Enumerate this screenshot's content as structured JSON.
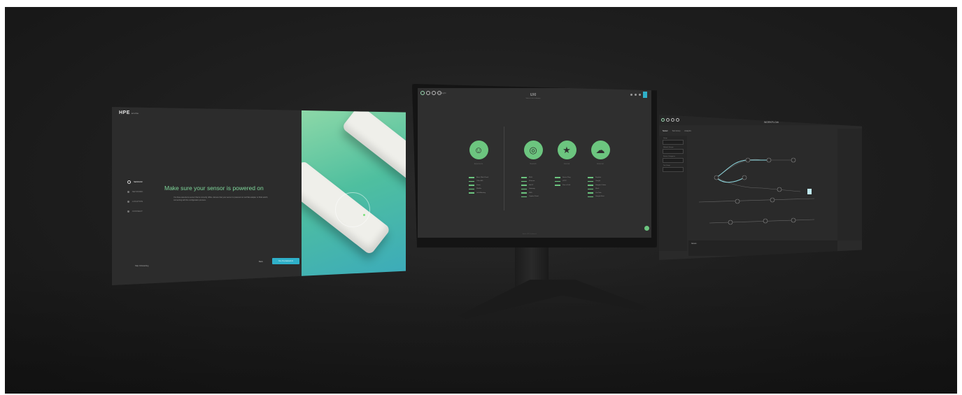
{
  "onboarding": {
    "logo_brand": "HPE",
    "logo_sub": "aruba",
    "steps": [
      {
        "label": "SENSOR",
        "active": true
      },
      {
        "label": "NETWORK",
        "active": false
      },
      {
        "label": "LOCATION",
        "active": false
      },
      {
        "label": "CONNECT",
        "active": false
      }
    ],
    "headline": "Make sure your sensor is powered on",
    "description": "You have selected a sensor that is currently offline. Ensure that your sensor is powered on via PoE adapter or PoE switch, connecting with the configuration process.",
    "skip_label": "Skip Onboarding",
    "back_label": "Back",
    "primary_label": "Yes, it's powered on",
    "hero_color_top": "#8fd9a8",
    "hero_color_bottom": "#3aa9bd"
  },
  "monitor": {
    "brand": "NetInsight",
    "title": "UXI",
    "subtitle": "Select a test category",
    "accent": "#6cc57f",
    "categories": [
      {
        "label": "Experience",
        "icon": "smile-icon",
        "glyph": "☺",
        "options": [
          "Basic Web Check",
          "Office365",
          "Zoom",
          "WebEx",
          "GoToMeeting"
        ]
      },
      {
        "label": "Network",
        "icon": "network-icon",
        "glyph": "◎",
        "options": [
          "Wi-Fi",
          "Ethernet",
          "DHCP",
          "Gateway",
          "DNS",
          "Captive Portal"
        ]
      },
      {
        "label": "Internal",
        "icon": "star-icon",
        "glyph": "★",
        "options": [
          "Server Ping",
          "HTTP",
          "Port of Call"
        ]
      },
      {
        "label": "External",
        "icon": "cloud-icon",
        "glyph": "☁",
        "options": [
          "Dropbox",
          "Google",
          "Google G Suite",
          "Slack",
          "YouTube",
          "Google Meet"
        ]
      }
    ],
    "footer": "Aruba UXI Dashboard"
  },
  "workflow": {
    "title": "WORKFLOW",
    "tabs": [
      "Sensor",
      "Test Group",
      "Analytics"
    ],
    "sidebar_labels": [
      "Group",
      "Network Groups",
      "Service Categories",
      "Test Group"
    ],
    "bottom_label": "Issues"
  }
}
